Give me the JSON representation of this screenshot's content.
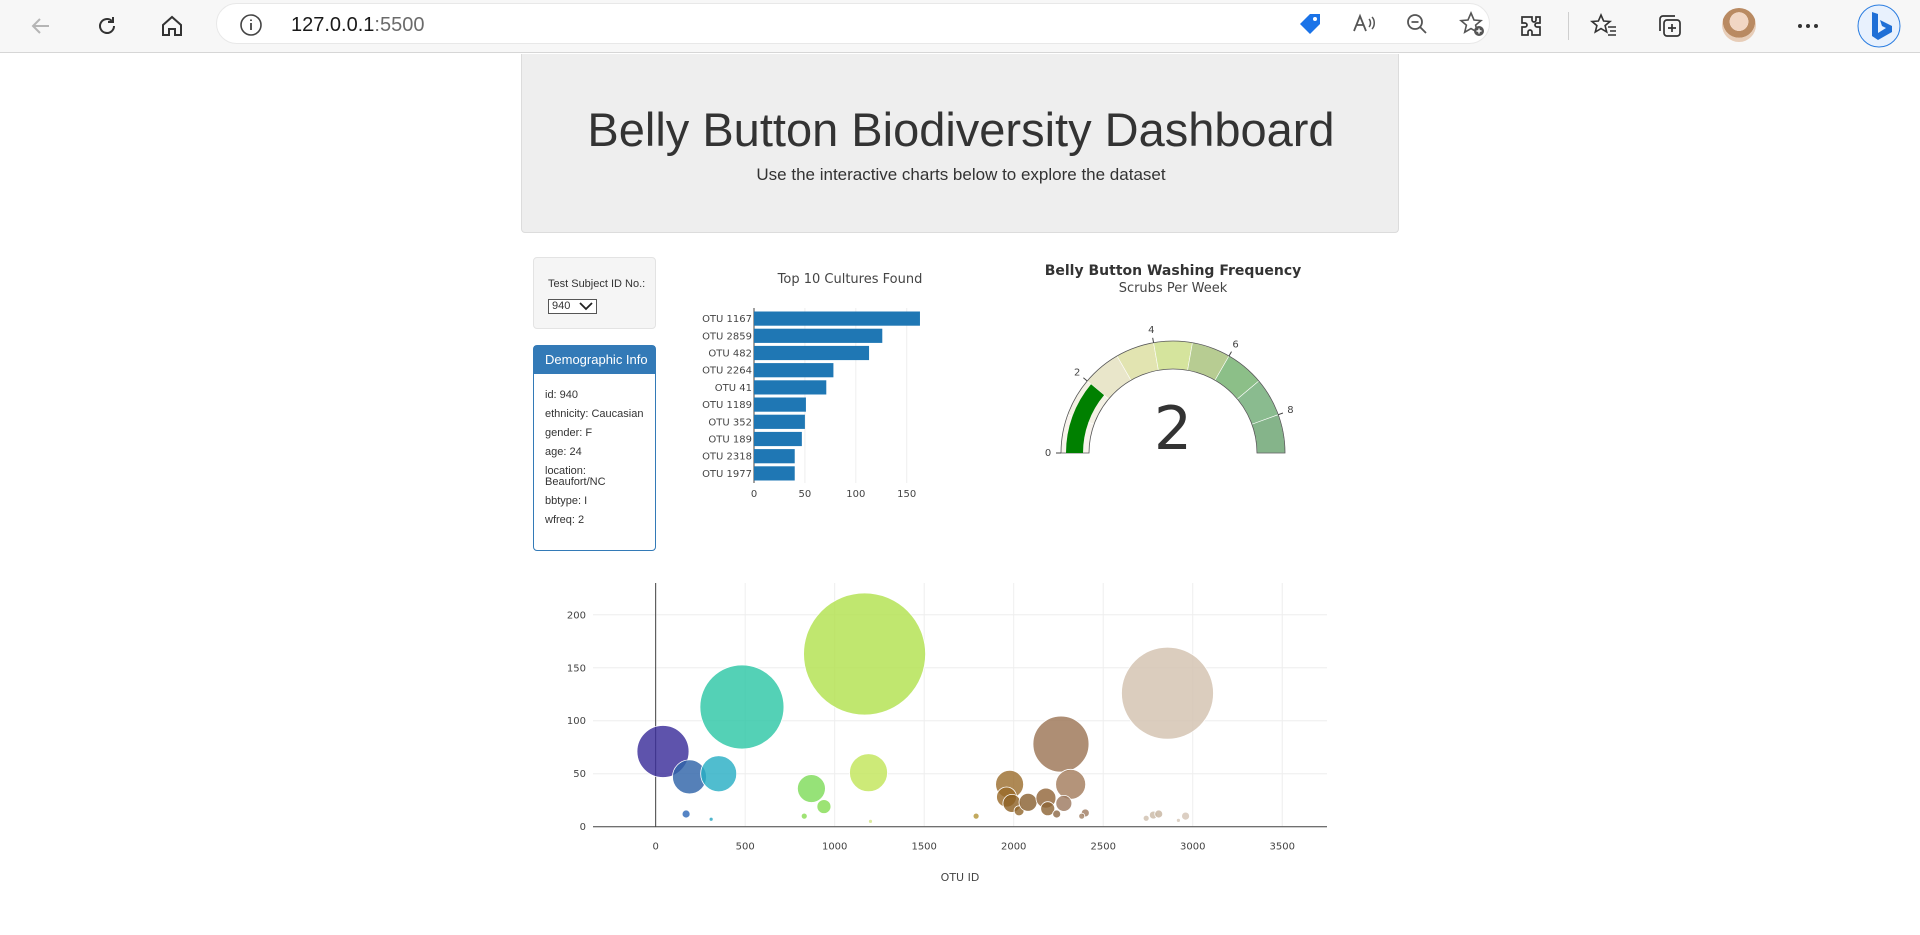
{
  "browser": {
    "url_host": "127.0.0.1",
    "url_port": ":5500",
    "icons": [
      "back-icon",
      "refresh-icon",
      "home-icon",
      "info-icon",
      "tag-icon",
      "read-aloud-icon",
      "zoom-out-icon",
      "add-favorite-icon",
      "extensions-icon",
      "favorites-icon",
      "collections-icon",
      "avatar",
      "more-icon",
      "bing-icon"
    ]
  },
  "header": {
    "title": "Belly Button Biodiversity Dashboard",
    "subtitle": "Use the interactive charts below to explore the dataset"
  },
  "selector": {
    "label": "Test Subject ID No.:",
    "value": "940"
  },
  "demographic": {
    "title": "Demographic Info",
    "lines": [
      "id: 940",
      "ethnicity: Caucasian",
      "gender: F",
      "age: 24",
      "location: Beaufort/NC",
      "bbtype: I",
      "wfreq: 2"
    ]
  },
  "colors": {
    "bar": "#1f77b4",
    "panel_blue": "#337ab7",
    "gauge_needle": "#008000"
  },
  "chart_data": [
    {
      "type": "bar",
      "title": "Top 10 Cultures Found",
      "orientation": "horizontal",
      "categories": [
        "OTU 1167",
        "OTU 2859",
        "OTU 482",
        "OTU 2264",
        "OTU 41",
        "OTU 1189",
        "OTU 352",
        "OTU 189",
        "OTU 2318",
        "OTU 1977"
      ],
      "values": [
        163,
        126,
        113,
        78,
        71,
        51,
        50,
        47,
        40,
        40
      ],
      "xlim": [
        0,
        165
      ],
      "xticks": [
        0,
        50,
        100,
        150
      ]
    },
    {
      "type": "gauge",
      "title": "Belly Button Washing Frequency",
      "subtitle": "Scrubs Per Week",
      "value": 2,
      "range": [
        0,
        9
      ],
      "tick_labels": [
        "0",
        "2",
        "4",
        "6",
        "8"
      ],
      "bands": [
        "#f8f3ec",
        "#f4f1e4",
        "#e9e6ca",
        "#e2e4b1",
        "#d5e49d",
        "#b7cc92",
        "#8cbf88",
        "#8abb8f",
        "#85b48a"
      ],
      "needle_color": "#008000"
    },
    {
      "type": "scatter",
      "mode": "bubble",
      "xlabel": "OTU ID",
      "xlim": [
        -350,
        3750
      ],
      "ylim": [
        -5,
        230
      ],
      "xticks": [
        0,
        500,
        1000,
        1500,
        2000,
        2500,
        3000,
        3500
      ],
      "yticks": [
        0,
        50,
        100,
        150,
        200
      ],
      "points": [
        {
          "x": 41,
          "y": 71,
          "r": 26,
          "color": "#3a2d9a"
        },
        {
          "x": 189,
          "y": 47,
          "r": 17,
          "color": "#2f64a8"
        },
        {
          "x": 352,
          "y": 50,
          "r": 18,
          "color": "#2aaec4"
        },
        {
          "x": 482,
          "y": 113,
          "r": 42,
          "color": "#2ec7a6"
        },
        {
          "x": 170,
          "y": 12,
          "r": 4,
          "color": "#3069b8"
        },
        {
          "x": 310,
          "y": 7,
          "r": 2,
          "color": "#2aa6c2"
        },
        {
          "x": 870,
          "y": 36,
          "r": 14,
          "color": "#7fdc5a"
        },
        {
          "x": 940,
          "y": 19,
          "r": 7,
          "color": "#86dd55"
        },
        {
          "x": 830,
          "y": 10,
          "r": 3,
          "color": "#8add55"
        },
        {
          "x": 1167,
          "y": 163,
          "r": 61,
          "color": "#b2e24f"
        },
        {
          "x": 1189,
          "y": 51,
          "r": 19,
          "color": "#c2e55a"
        },
        {
          "x": 1200,
          "y": 5,
          "r": 2,
          "color": "#d4e68a"
        },
        {
          "x": 1790,
          "y": 10,
          "r": 3,
          "color": "#b4963a"
        },
        {
          "x": 1977,
          "y": 40,
          "r": 14,
          "color": "#9c6f30"
        },
        {
          "x": 1960,
          "y": 28,
          "r": 10,
          "color": "#9a6a2a"
        },
        {
          "x": 1990,
          "y": 22,
          "r": 9,
          "color": "#8e6126"
        },
        {
          "x": 2030,
          "y": 15,
          "r": 5,
          "color": "#93682e"
        },
        {
          "x": 2080,
          "y": 23,
          "r": 9,
          "color": "#8a6232"
        },
        {
          "x": 2180,
          "y": 27,
          "r": 10,
          "color": "#93673a"
        },
        {
          "x": 2190,
          "y": 17,
          "r": 7,
          "color": "#8e6536"
        },
        {
          "x": 2264,
          "y": 78,
          "r": 28,
          "color": "#9c7556"
        },
        {
          "x": 2318,
          "y": 40,
          "r": 15,
          "color": "#a47d5d"
        },
        {
          "x": 2280,
          "y": 22,
          "r": 8,
          "color": "#9e7a60"
        },
        {
          "x": 2240,
          "y": 12,
          "r": 4,
          "color": "#8e6a48"
        },
        {
          "x": 2400,
          "y": 13,
          "r": 4,
          "color": "#a07d62"
        },
        {
          "x": 2380,
          "y": 10,
          "r": 3,
          "color": "#a48266"
        },
        {
          "x": 2859,
          "y": 126,
          "r": 46,
          "color": "#d3c2b0"
        },
        {
          "x": 2780,
          "y": 11,
          "r": 4,
          "color": "#cbb9a6"
        },
        {
          "x": 2810,
          "y": 12,
          "r": 4,
          "color": "#c7b4a0"
        },
        {
          "x": 2740,
          "y": 8,
          "r": 3,
          "color": "#cfc0ae"
        },
        {
          "x": 2960,
          "y": 10,
          "r": 4,
          "color": "#d4c5b6"
        },
        {
          "x": 2920,
          "y": 6,
          "r": 2,
          "color": "#d6c8b9"
        }
      ]
    }
  ]
}
